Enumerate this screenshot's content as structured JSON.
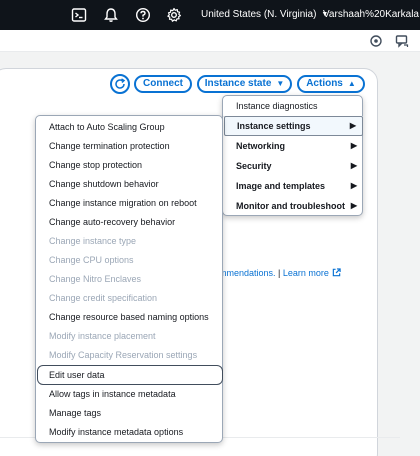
{
  "topbar": {
    "region": "United States (N. Virginia)",
    "user": "Varshaah%20Karkala",
    "icons": [
      "cloudshell-icon",
      "bell-icon",
      "help-icon",
      "settings-icon"
    ]
  },
  "subbar": {
    "icons": [
      "notification-settings-icon",
      "feedback-icon"
    ]
  },
  "toolbar": {
    "connect_label": "Connect",
    "instance_state_label": "Instance state",
    "actions_label": "Actions"
  },
  "background": {
    "recommendations_text": "mmendations.",
    "separator": " | ",
    "learn_more": "Learn more"
  },
  "actions_menu": {
    "items": [
      {
        "label": "Instance diagnostics",
        "has_submenu": false
      },
      {
        "label": "Instance settings",
        "has_submenu": true,
        "expanded": true
      },
      {
        "label": "Networking",
        "has_submenu": true
      },
      {
        "label": "Security",
        "has_submenu": true
      },
      {
        "label": "Image and templates",
        "has_submenu": true
      },
      {
        "label": "Monitor and troubleshoot",
        "has_submenu": true
      }
    ]
  },
  "instance_settings_menu": {
    "items": [
      {
        "label": "Attach to Auto Scaling Group",
        "disabled": false
      },
      {
        "label": "Change termination protection",
        "disabled": false
      },
      {
        "label": "Change stop protection",
        "disabled": false
      },
      {
        "label": "Change shutdown behavior",
        "disabled": false
      },
      {
        "label": "Change instance migration on reboot",
        "disabled": false
      },
      {
        "label": "Change auto-recovery behavior",
        "disabled": false
      },
      {
        "label": "Change instance type",
        "disabled": true
      },
      {
        "label": "Change CPU options",
        "disabled": true
      },
      {
        "label": "Change Nitro Enclaves",
        "disabled": true
      },
      {
        "label": "Change credit specification",
        "disabled": true
      },
      {
        "label": "Change resource based naming options",
        "disabled": false
      },
      {
        "label": "Modify instance placement",
        "disabled": true
      },
      {
        "label": "Modify Capacity Reservation settings",
        "disabled": true
      },
      {
        "label": "Edit user data",
        "disabled": false,
        "focused": true
      },
      {
        "label": "Allow tags in instance metadata",
        "disabled": false
      },
      {
        "label": "Manage tags",
        "disabled": false
      },
      {
        "label": "Modify instance metadata options",
        "disabled": false
      }
    ]
  },
  "colors": {
    "topbar_bg": "#0f141a",
    "link_blue": "#0972d3",
    "disabled_text": "#9ba7b6"
  }
}
